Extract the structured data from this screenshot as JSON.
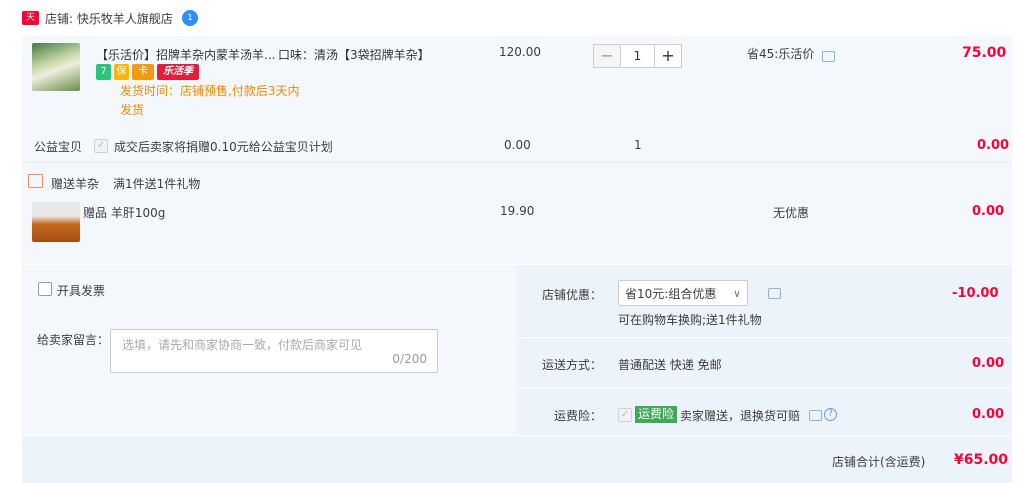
{
  "shop": {
    "badge_text": "天猫",
    "label": "店铺: 快乐牧羊人旗舰店",
    "ww_icon_text": "1"
  },
  "item": {
    "title": "【乐活价】招牌羊杂内蒙羊汤羊...",
    "sku": "口味：清汤【3袋招牌羊杂】",
    "tags": [
      {
        "text": "7",
        "color": "#2ec27e",
        "icon": "seven-day-return-icon"
      },
      {
        "text": "保",
        "color": "#ffb400",
        "icon": "guarantee-icon"
      },
      {
        "text": "卡",
        "color": "#f29a16",
        "icon": "card-icon"
      },
      {
        "text": "乐活季",
        "color": "#e21e3d",
        "icon": "lehuoji-icon"
      }
    ],
    "ship_time": "发货时间：店铺预售,付款后3天内",
    "ship_time_2": "发货",
    "unit_price": "120.00",
    "quantity": "1",
    "minus_label": "−",
    "plus_label": "+",
    "discount": "省45:乐活价",
    "subtotal": "75.00"
  },
  "charity": {
    "label": "公益宝贝",
    "text": "成交后卖家将捐赠0.10元给公益宝贝计划",
    "price": "0.00",
    "qty": "1",
    "subtotal": "0.00"
  },
  "gift": {
    "header": "赠送羊杂",
    "rule": "满1件送1件礼物",
    "name": "赠品 羊肝100g",
    "price": "19.90",
    "discount": "无优惠",
    "subtotal": "0.00"
  },
  "invoice": {
    "label": "开具发票"
  },
  "message": {
    "label": "给卖家留言：",
    "placeholder": "选填，请先和商家协商一致，付款后商家可见",
    "counter": "0/200"
  },
  "shop_discount": {
    "label": "店铺优惠：",
    "selected": "省10元:组合优惠",
    "note": "可在购物车换购;送1件礼物",
    "value": "-10.00"
  },
  "shipping": {
    "label": "运送方式：",
    "value": "普通配送 快递 免邮",
    "price": "0.00"
  },
  "insurance": {
    "label": "运费险：",
    "tag": "运费险",
    "text": "卖家赠送，退换货可赔",
    "price": "0.00"
  },
  "total": {
    "label": "店铺合计(含运费)",
    "value": "¥65.00"
  },
  "colors": {
    "accent_red": "#ff0036",
    "orange": "#f08800",
    "panel_bg": "#f4f8fd"
  }
}
